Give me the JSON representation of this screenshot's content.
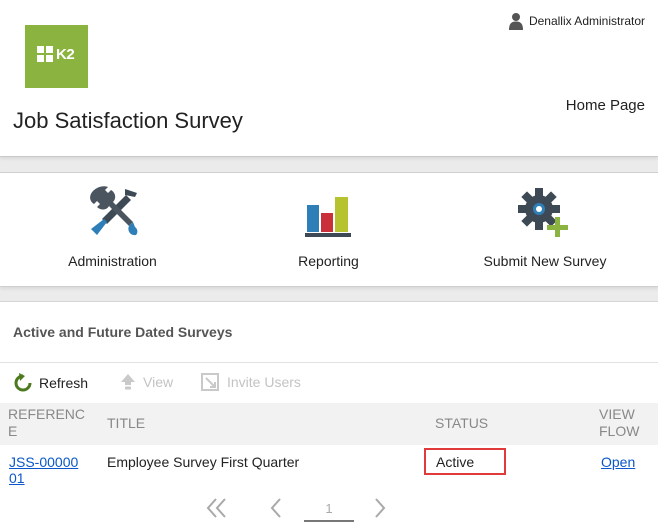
{
  "header": {
    "logo_text": "K2",
    "user_name": "Denallix Administrator",
    "home_link": "Home Page",
    "page_title": "Job Satisfaction Survey"
  },
  "tiles": [
    {
      "label": "Administration",
      "icon": "tools-icon"
    },
    {
      "label": "Reporting",
      "icon": "bar-chart-icon"
    },
    {
      "label": "Submit New Survey",
      "icon": "gear-plus-icon"
    }
  ],
  "surveys": {
    "section_title": "Active and Future Dated Surveys",
    "toolbar": {
      "refresh": "Refresh",
      "view": "View",
      "invite": "Invite Users"
    },
    "columns": {
      "reference": "REFERENCE",
      "title": "TITLE",
      "status": "STATUS",
      "view_flow": "VIEW FLOW"
    },
    "rows": [
      {
        "reference": "JSS-0000001",
        "title": "Employee Survey First Quarter",
        "status": "Active",
        "view_flow": "Open"
      }
    ],
    "pager": {
      "current_page": "1"
    }
  },
  "colors": {
    "brand_green": "#8ab43f",
    "link_blue": "#0b57c9",
    "highlight_red": "#e03a3a"
  }
}
